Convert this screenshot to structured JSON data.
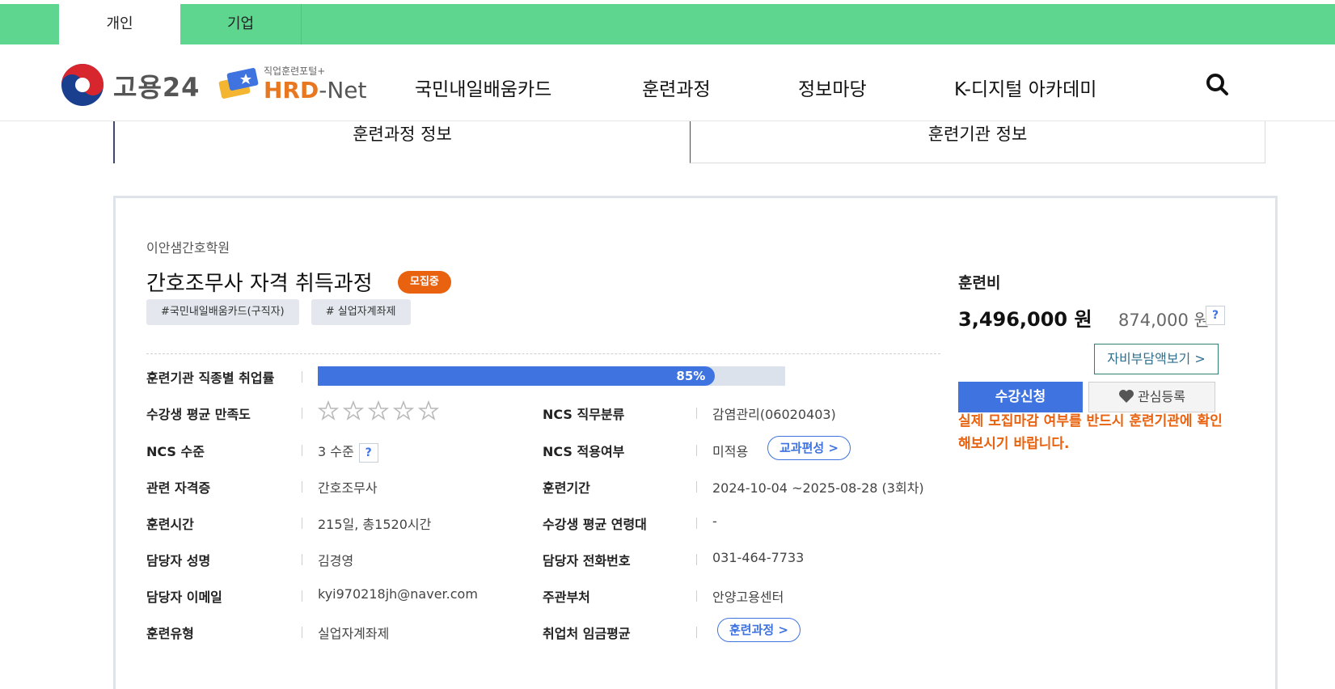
{
  "topbar": {
    "tabs": [
      "개인",
      "기업"
    ]
  },
  "header": {
    "logo1_text": "고용24",
    "logo2_sub": "직업훈련포털+",
    "logo2_main_a": "HRD",
    "logo2_main_b": "-Net",
    "nav": [
      "국민내일배움카드",
      "훈련과정",
      "정보마당",
      "K-디지털 아카데미"
    ]
  },
  "section_tabs": [
    "훈련과정 정보",
    "훈련기관 정보"
  ],
  "course": {
    "institute": "이안샘간호학원",
    "title": "간호조무사 자격 취득과정",
    "status_badge": "모집중",
    "tags": [
      "#국민내일배움카드(구직자)",
      "# 실업자계좌제"
    ]
  },
  "details": {
    "employment_rate_label": "훈련기관 직종별 취업률",
    "employment_rate_text": "85%",
    "employment_rate": 0.85,
    "satisfaction_label": "수강생 평균 만족도",
    "satisfaction_stars": 0,
    "satisfaction_max": 5,
    "ncs_class_label": "NCS 직무분류",
    "ncs_class_value": "감염관리(06020403)",
    "ncs_level_label": "NCS 수준",
    "ncs_level_value": "3 수준",
    "ncs_apply_label": "NCS 적용여부",
    "ncs_apply_value": "미적용",
    "curriculum_button": "교과편성 >",
    "cert_label": "관련 자격증",
    "cert_value": "간호조무사",
    "period_label": "훈련기간",
    "period_value": "2024-10-04 ~2025-08-28 (3회차)",
    "hours_label": "훈련시간",
    "hours_value": "215일, 총1520시간",
    "age_label": "수강생 평균 연령대",
    "age_value": "-",
    "manager_label": "담당자 성명",
    "manager_value": "김경영",
    "phone_label": "담당자 전화번호",
    "phone_value": "031-464-7733",
    "email_label": "담당자 이메일",
    "email_value": "kyi970218jh@naver.com",
    "agency_label": "주관부처",
    "agency_value": "안양고용센터",
    "type_label": "훈련유형",
    "type_value": "실업자계좌제",
    "wage_label": "취업처 임금평균",
    "training_course_button": "훈련과정 >",
    "help_mark": "?"
  },
  "fees": {
    "label": "훈련비",
    "total": "3,496,000 원",
    "self_pay": "874,000 원",
    "self_pay_button": "자비부담액보기 >",
    "apply_button": "수강신청",
    "favorite_button": "관심등록",
    "notice": "실제 모집마감 여부를 반드시 훈련기관에 확인해보시기 바랍니다."
  },
  "colors": {
    "brand_green": "#5ed68f",
    "primary_blue": "#3f73e0",
    "accent_orange": "#e8620f"
  }
}
